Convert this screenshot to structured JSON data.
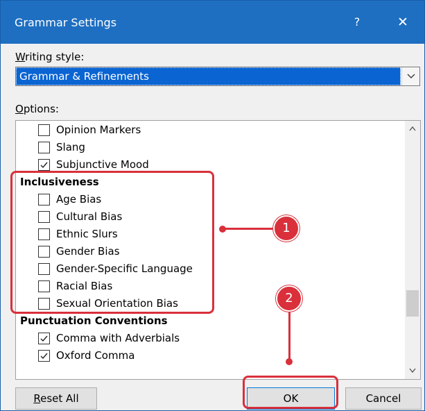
{
  "dialog": {
    "title": "Grammar Settings",
    "help": "?",
    "close": "✕"
  },
  "writing_style": {
    "label_underlined": "W",
    "label_rest": "riting style:",
    "value": "Grammar & Refinements"
  },
  "options": {
    "label_underlined": "O",
    "label_rest": "ptions:",
    "items": [
      {
        "type": "checkbox",
        "label": "Opinion Markers",
        "checked": false
      },
      {
        "type": "checkbox",
        "label": "Slang",
        "checked": false
      },
      {
        "type": "checkbox",
        "label": "Subjunctive Mood",
        "checked": true
      },
      {
        "type": "heading",
        "label": "Inclusiveness"
      },
      {
        "type": "checkbox",
        "label": "Age Bias",
        "checked": false
      },
      {
        "type": "checkbox",
        "label": "Cultural Bias",
        "checked": false
      },
      {
        "type": "checkbox",
        "label": "Ethnic Slurs",
        "checked": false
      },
      {
        "type": "checkbox",
        "label": "Gender Bias",
        "checked": false
      },
      {
        "type": "checkbox",
        "label": "Gender-Specific Language",
        "checked": false
      },
      {
        "type": "checkbox",
        "label": "Racial Bias",
        "checked": false
      },
      {
        "type": "checkbox",
        "label": "Sexual Orientation Bias",
        "checked": false
      },
      {
        "type": "heading",
        "label": "Punctuation Conventions"
      },
      {
        "type": "checkbox",
        "label": "Comma with Adverbials",
        "checked": true
      },
      {
        "type": "checkbox",
        "label": "Oxford Comma",
        "checked": true
      }
    ]
  },
  "buttons": {
    "reset_underlined": "R",
    "reset_rest": "eset All",
    "ok": "OK",
    "cancel": "Cancel"
  },
  "annotations": {
    "marker_1": "1",
    "marker_2": "2",
    "color": "#d9303b"
  },
  "colors": {
    "titlebar": "#1e6fc1",
    "selection": "#0a64d2"
  }
}
